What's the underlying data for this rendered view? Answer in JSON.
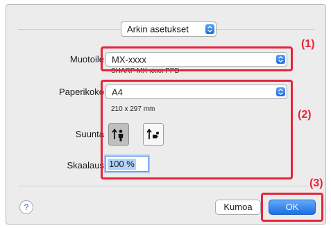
{
  "dialog": {
    "section_popup": {
      "value": "Arkin asetukset"
    }
  },
  "format": {
    "label": "Muotoile",
    "printer_value": "MX-xxxx",
    "printer_subtitle": "SHARP MX-xxxx PPD"
  },
  "paper": {
    "label": "Paperikoko",
    "value": "A4",
    "dimensions": "210 x 297 mm"
  },
  "orientation": {
    "label": "Suunta",
    "selected": "portrait"
  },
  "scale": {
    "label": "Skaalaus",
    "value": "100 %"
  },
  "buttons": {
    "help": "?",
    "cancel": "Kumoa",
    "ok": "OK"
  },
  "callouts": [
    "(1)",
    "(2)",
    "(3)"
  ],
  "colors": {
    "callout_red": "#e8233b",
    "accent_blue": "#1c6fe3"
  }
}
